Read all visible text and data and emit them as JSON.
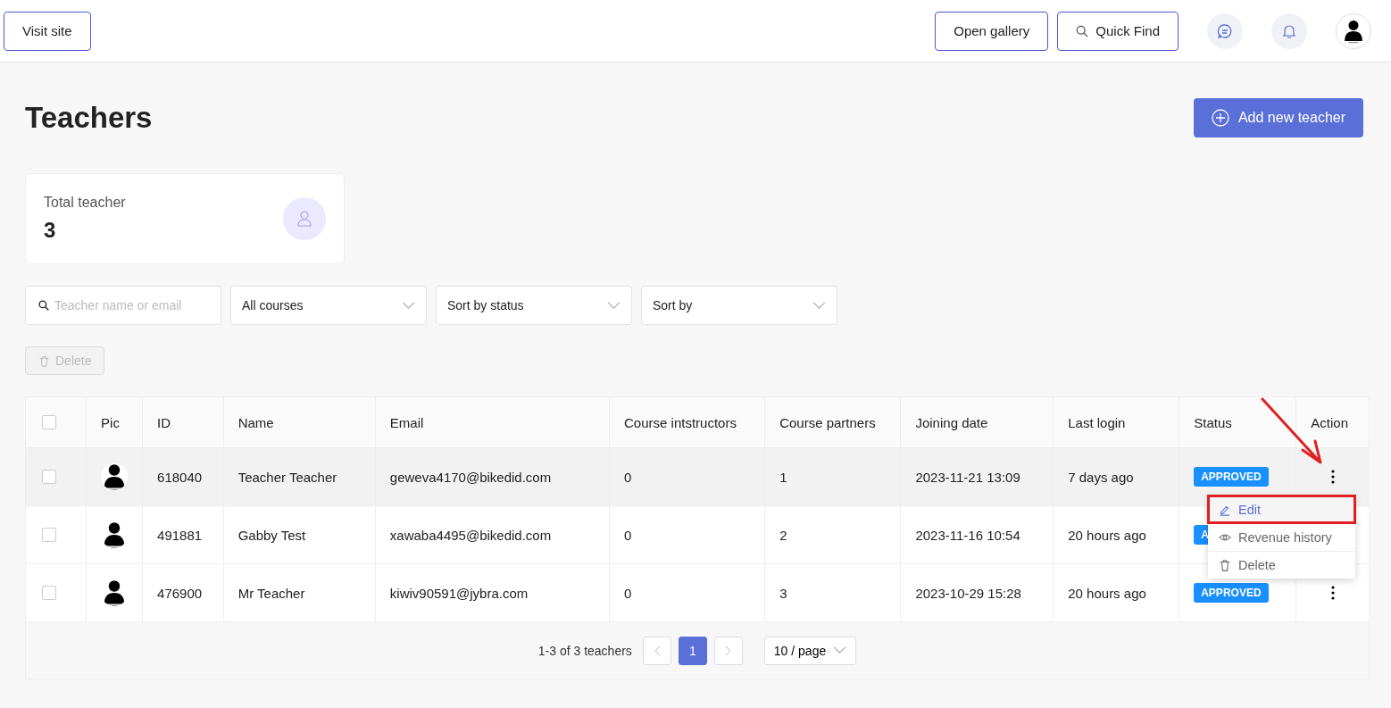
{
  "topbar": {
    "visit_site": "Visit site",
    "open_gallery": "Open gallery",
    "quick_find": "Quick Find"
  },
  "page_title": "Teachers",
  "add_button": "Add new teacher",
  "stat_card": {
    "label": "Total teacher",
    "value": "3"
  },
  "filters": {
    "search_placeholder": "Teacher name or email",
    "courses": "All courses",
    "status_sort": "Sort by status",
    "sort": "Sort by"
  },
  "delete_button": {
    "label": "Delete",
    "disabled": true
  },
  "table": {
    "columns": [
      "Pic",
      "ID",
      "Name",
      "Email",
      "Course intstructors",
      "Course partners",
      "Joining date",
      "Last login",
      "Status",
      "Action"
    ],
    "header_checked": false,
    "rows": [
      {
        "checked": false,
        "hovered": true,
        "id": "618040",
        "name": "Teacher Teacher",
        "email": "geweva4170@bikedid.com",
        "instructors": "0",
        "partners": "1",
        "joined": "2023-11-21 13:09",
        "last_login": "7 days ago",
        "status": "APPROVED"
      },
      {
        "checked": false,
        "hovered": false,
        "id": "491881",
        "name": "Gabby Test",
        "email": "xawaba4495@bikedid.com",
        "instructors": "0",
        "partners": "2",
        "joined": "2023-11-16 10:54",
        "last_login": "20 hours ago",
        "status": "A"
      },
      {
        "checked": false,
        "hovered": false,
        "id": "476900",
        "name": "Mr Teacher",
        "email": "kiwiv90591@jybra.com",
        "instructors": "0",
        "partners": "3",
        "joined": "2023-10-29 15:28",
        "last_login": "20 hours ago",
        "status": "APPROVED"
      }
    ]
  },
  "action_menu": [
    {
      "kind": "edit",
      "label": "Edit",
      "selected": true
    },
    {
      "kind": "view",
      "label": "Revenue history",
      "selected": false
    },
    {
      "kind": "delete",
      "label": "Delete",
      "selected": false
    }
  ],
  "pagination": {
    "summary": "1-3 of 3 teachers",
    "pages": [
      {
        "label": "1",
        "selected": true
      }
    ],
    "page_size": "10 / page"
  }
}
